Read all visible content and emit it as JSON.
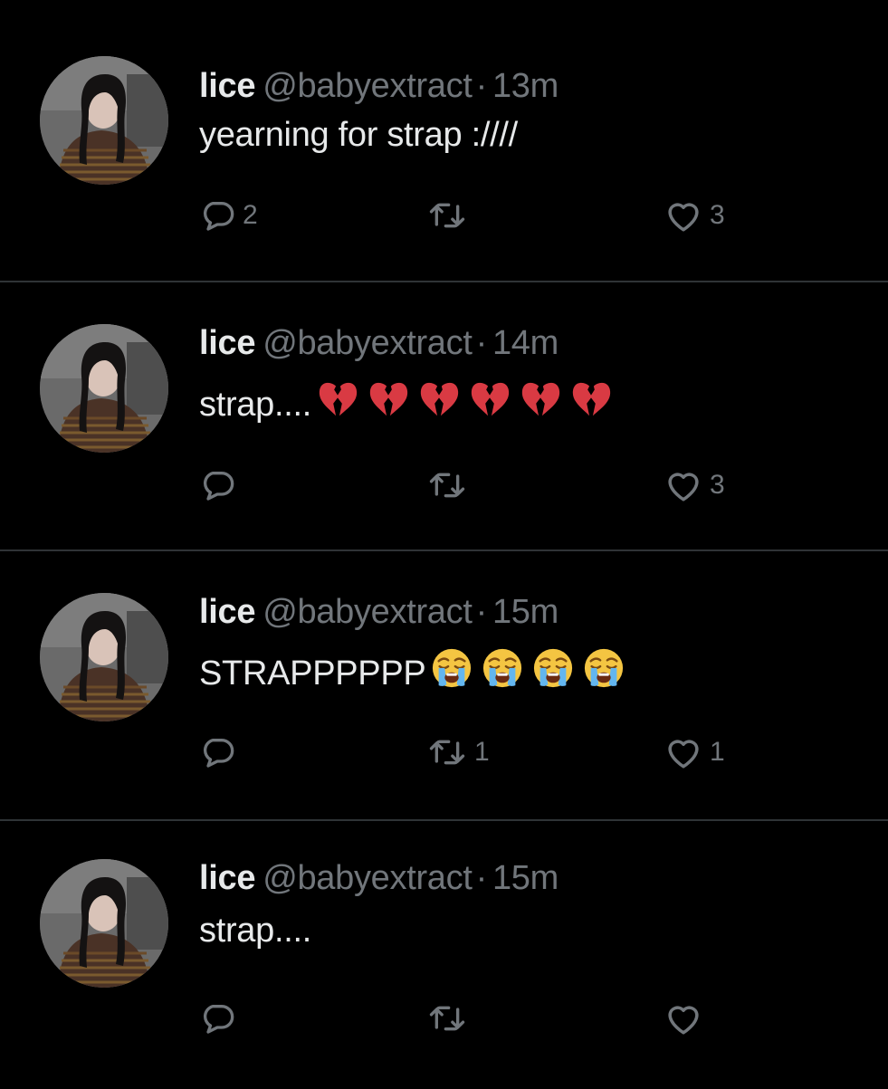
{
  "theme": {
    "background": "#000000",
    "primary_text": "#e7e9ea",
    "secondary_text": "#71767b",
    "divider": "#2f3336"
  },
  "tweets": [
    {
      "display_name": "lice",
      "handle": "@babyextract",
      "separator": "·",
      "time": "13m",
      "text": "yearning for strap :////",
      "emoji_name": "",
      "emoji_count": 0,
      "replies": "2",
      "retweets": "",
      "likes": "3"
    },
    {
      "display_name": "lice",
      "handle": "@babyextract",
      "separator": "·",
      "time": "14m",
      "text": "strap....",
      "emoji_name": "broken-heart",
      "emoji_count": 6,
      "replies": "",
      "retweets": "",
      "likes": "3"
    },
    {
      "display_name": "lice",
      "handle": "@babyextract",
      "separator": "·",
      "time": "15m",
      "text": "STRAPPPPPP",
      "emoji_name": "loudly-crying-face",
      "emoji_count": 4,
      "replies": "",
      "retweets": "1",
      "likes": "1"
    },
    {
      "display_name": "lice",
      "handle": "@babyextract",
      "separator": "·",
      "time": "15m",
      "text": "strap....",
      "emoji_name": "",
      "emoji_count": 0,
      "replies": "",
      "retweets": "",
      "likes": ""
    }
  ],
  "icons": {
    "reply": "reply-icon",
    "retweet": "retweet-icon",
    "like": "heart-icon",
    "broken_heart": "broken-heart-emoji",
    "crying": "loudly-crying-face-emoji"
  }
}
